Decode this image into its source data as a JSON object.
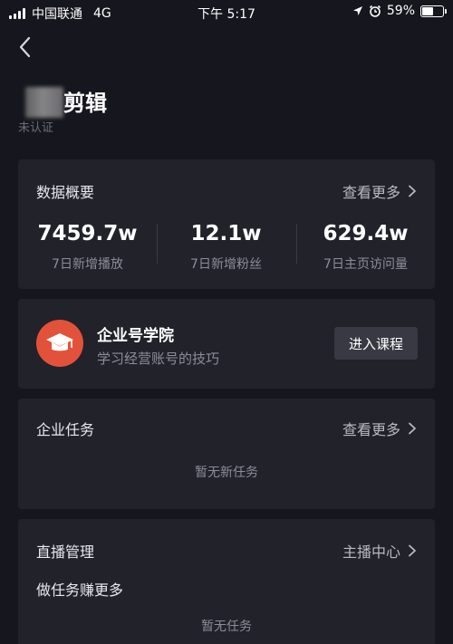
{
  "status_bar": {
    "carrier": "中国联通",
    "network": "4G",
    "time": "下午 5:17",
    "battery": "59%",
    "battery_level": 0.59
  },
  "profile": {
    "name": "剪辑",
    "subtitle": "未认证"
  },
  "data_overview": {
    "title": "数据概要",
    "more_label": "查看更多",
    "stats": [
      {
        "value": "7459.7w",
        "label": "7日新增播放"
      },
      {
        "value": "12.1w",
        "label": "7日新增粉丝"
      },
      {
        "value": "629.4w",
        "label": "7日主页访问量"
      }
    ]
  },
  "academy": {
    "title": "企业号学院",
    "subtitle": "学习经营账号的技巧",
    "button_label": "进入课程",
    "icon_color": "#e2523a"
  },
  "tasks": {
    "title": "企业任务",
    "more_label": "查看更多",
    "empty_text": "暂无新任务"
  },
  "live": {
    "title": "直播管理",
    "link_label": "主播中心",
    "subheading": "做任务赚更多",
    "empty_text": "暂无任务"
  },
  "colors": {
    "background": "#16161e",
    "card": "#22222b",
    "accent": "#e2523a"
  }
}
